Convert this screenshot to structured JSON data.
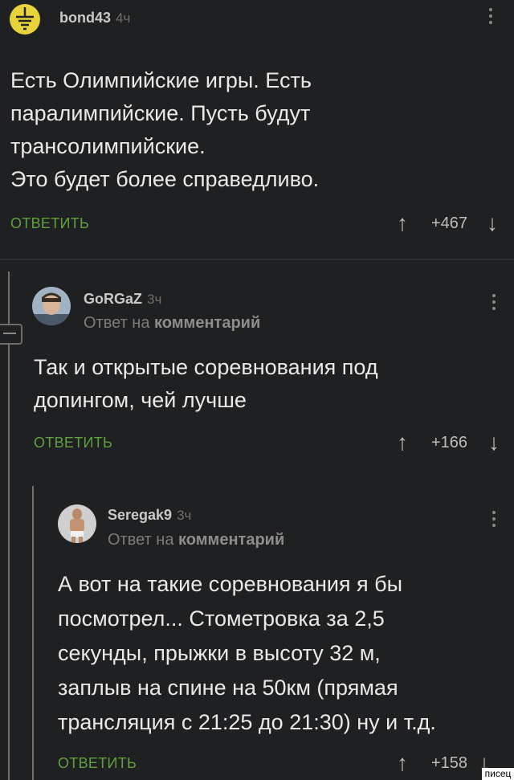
{
  "comments": [
    {
      "username": "bond43",
      "time": "4ч",
      "lines": [
        "Есть Олимпийские игры. Есть",
        "паралимпийские. Пусть будут",
        "трансолимпийские.",
        "Это будет более справедливо."
      ],
      "reply_label": "ОТВЕТИТЬ",
      "rating": "+467"
    },
    {
      "username": "GoRGaZ",
      "time": "3ч",
      "reply_to_prefix": "Ответ на",
      "reply_to_target": "комментарий",
      "lines": [
        "Так и открытые соревнования под",
        "допингом, чей лучше"
      ],
      "reply_label": "ОТВЕТИТЬ",
      "rating": "+166"
    },
    {
      "username": "Seregak9",
      "time": "3ч",
      "reply_to_prefix": "Ответ на",
      "reply_to_target": "комментарий",
      "lines": [
        "А вот на такие соревнования я бы",
        "посмотрел... Стометровка за 2,5",
        "секунды, прыжки в высоту 32 м,",
        "заплыв на спине на 50км (прямая",
        "трансляция с 21:25 до 21:30) ну и т.д."
      ],
      "reply_label": "ОТВЕТИТЬ",
      "rating": "+158"
    }
  ],
  "watermark": "писец",
  "icons": {
    "upvote": "arrow-up-icon",
    "downvote": "arrow-down-icon",
    "menu": "kebab-menu-icon",
    "avatar_top": "ground-symbol-icon"
  },
  "colors": {
    "background": "#1f2022",
    "accent_green": "#5fa13b",
    "avatar_yellow": "#e8d33a"
  }
}
